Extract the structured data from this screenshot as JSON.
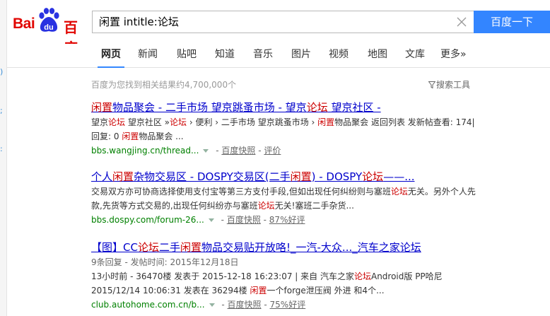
{
  "search": {
    "query": "闲置 intitle:论坛",
    "button_label": "百度一下"
  },
  "logo": {
    "part1": "Bai",
    "paw_text": "du",
    "part2": "百度"
  },
  "tabs": [
    "网页",
    "新闻",
    "贴吧",
    "知道",
    "音乐",
    "图片",
    "视频",
    "地图",
    "文库",
    "更多»"
  ],
  "stats": "百度为您找到相关结果约4,700,000个",
  "tools_label": "搜索工具",
  "results": [
    {
      "title_html": "<em>闲置</em>物品聚会 - 二手市场 望京跳蚤市场 - 望京<em>论坛</em> 望京社区 -",
      "abstract_html": "望京<em>论坛</em> 望京社区 »<em>论坛</em> › 便利 › 二手市场 望京跳蚤市场 › <em>闲置</em>物品聚会 返回列表 发新帖查看: 174|回复: 0 <em>闲置</em>物品聚会 ...",
      "url": "bbs.wangjing.cn/thread...",
      "snapshot": "百度快照",
      "extra": "评价"
    },
    {
      "title_html": "个人<em>闲置</em>杂物交易区 - DOSPY交易区(二手<em>闲置</em>) - DOSPY<em>论坛</em>——...",
      "abstract_html": "交易双方亦可协商选择使用支付宝等第三方支付手段,但如出现任何纠纷则与塞班<em>论坛</em>无关。另外个人先款,先货等方式交易的,出现任何纠纷亦与塞班<em>论坛</em>无关!塞班二手杂货...",
      "url": "bbs.dospy.com/forum-26...",
      "snapshot": "百度快照",
      "extra": "87%好评"
    },
    {
      "title_html": "【图】CC<em>论坛</em>二手<em>闲置</em>物品交易贴开放咯!_一汽-大众..._汽车之家论坛",
      "meta": "9条回复 - 发帖时间: 2015年12月18日",
      "abstract_html": "13小时前 - 36470楼 发表于 2015-12-18 16:23:07 | 来自 汽车之家<em>论坛</em>Android版 PP哈尼<br>2015/12/14 10:06:31 发表在 36294楼 <em>闲置</em>一个forge泄压阀 外进 和4个...",
      "url": "club.autohome.com.cn/b...",
      "snapshot": "百度快照",
      "extra": "75%好评"
    }
  ],
  "colors": {
    "brand_red": "#e10602",
    "brand_blue": "#3385ff",
    "link": "#0000cc",
    "url_green": "#008000",
    "highlight": "#c00"
  }
}
